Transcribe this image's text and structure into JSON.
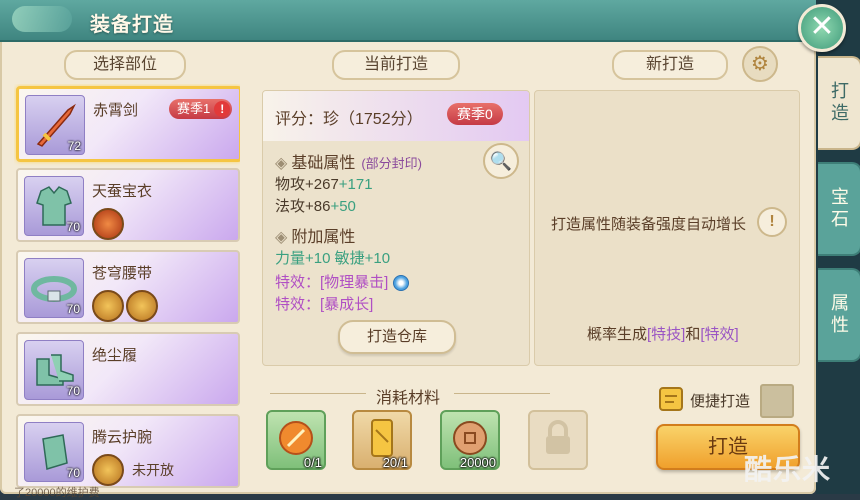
{
  "window": {
    "title": "装备打造",
    "close_label": "✕"
  },
  "headers": {
    "select_part": "选择部位",
    "current": "当前打造",
    "new": "新打造"
  },
  "side_tabs": [
    "打造",
    "宝石",
    "属性"
  ],
  "equipment_list": [
    {
      "name": "赤霄剑",
      "level": "72",
      "season": "赛季1",
      "alert": "!",
      "icon": "sword-icon"
    },
    {
      "name": "天蚕宝衣",
      "level": "70",
      "icon": "armor-icon"
    },
    {
      "name": "苍穹腰带",
      "level": "70",
      "icon": "belt-icon"
    },
    {
      "name": "绝尘履",
      "level": "70",
      "icon": "boots-icon"
    },
    {
      "name": "腾云护腕",
      "level": "70",
      "icon": "bracer-icon",
      "gem_note": "未开放"
    }
  ],
  "current_forge": {
    "score": "评分：珍（1752分）",
    "season": "赛季0",
    "base_title": "基础属性",
    "base_note": "(部分封印)",
    "stats": [
      {
        "label": "物攻+267",
        "bonus": "+171"
      },
      {
        "label": "法攻+86",
        "bonus": "+50"
      }
    ],
    "extra_title": "附加属性",
    "extra_line": "力量+10    敏捷+10",
    "special1": "特效：[物理暴击]",
    "special2": "特效：[暴成长]",
    "warehouse_button": "打造仓库"
  },
  "new_forge": {
    "auto_text": "打造属性随装备强度自动增长",
    "prob_prefix": "概率生成",
    "prob_a": "[特技]",
    "prob_and": "和",
    "prob_b": "[特效]"
  },
  "materials": {
    "title": "消耗材料",
    "items": [
      {
        "icon": "forge-stone-icon",
        "count": "0/1"
      },
      {
        "icon": "scroll-icon",
        "count": "20/1"
      },
      {
        "icon": "coin-icon",
        "count": "20000"
      },
      {
        "icon": "lock-icon",
        "count": ""
      }
    ]
  },
  "actions": {
    "quick_label": "便捷打造",
    "forge_label": "打造"
  },
  "watermark": "酷乐米",
  "bottom_text": "了20000的维护费",
  "colors": {
    "accent": "#5fa8a0",
    "season_red": "#c53a45",
    "forge_gold": "#f0a02c",
    "special_purple": "#b04fc4",
    "bonus_green": "#3aa080"
  }
}
